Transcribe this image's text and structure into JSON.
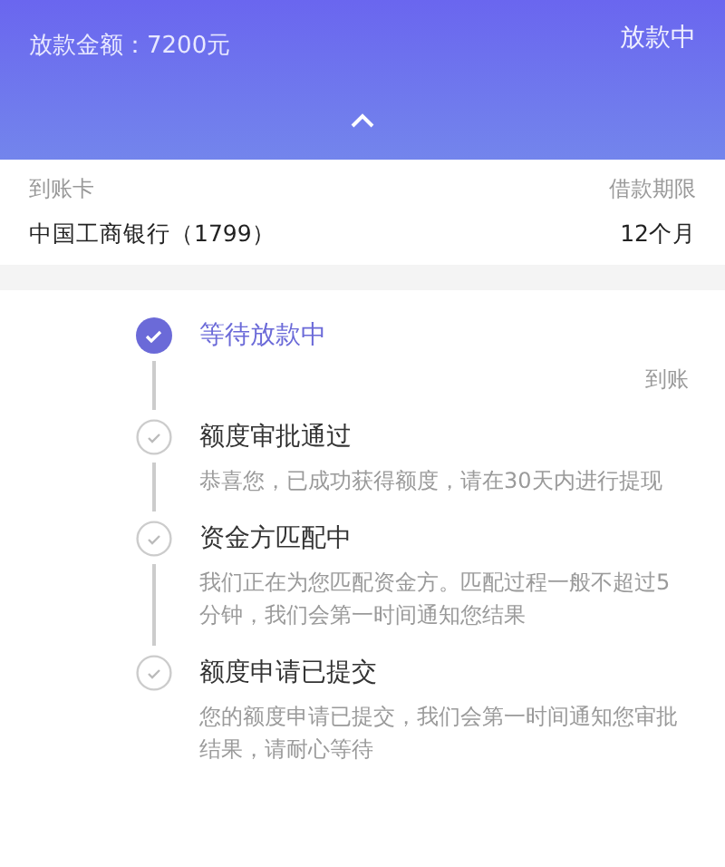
{
  "header": {
    "amount": "放款金额：7200元",
    "status": "放款中"
  },
  "loan_info": {
    "card_label": "到账卡",
    "card_value": "中国工商银行（1799）",
    "term_label": "借款期限",
    "term_value": "12个月"
  },
  "steps": [
    {
      "title": "等待放款中",
      "description": "到账",
      "active": true
    },
    {
      "title": "额度审批通过",
      "description": "恭喜您，已成功获得额度，请在30天内进行提现",
      "active": false
    },
    {
      "title": "资金方匹配中",
      "description": "我们正在为您匹配资金方。匹配过程一般不超过5分钟，我们会第一时间通知您结果",
      "active": false
    },
    {
      "title": "额度申请已提交",
      "description": "您的额度申请已提交，我们会第一时间通知您审批结果，请耐心等待",
      "active": false
    }
  ]
}
